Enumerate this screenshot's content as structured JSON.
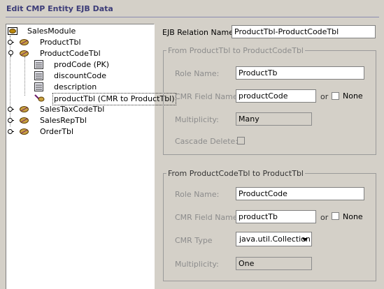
{
  "header": {
    "title": "Edit CMP Entity EJB Data"
  },
  "tree": {
    "root": "SalesModule",
    "items": [
      {
        "label": "ProductTbl"
      },
      {
        "label": "ProductCodeTbl"
      },
      {
        "label": "prodCode (PK)"
      },
      {
        "label": "discountCode"
      },
      {
        "label": "description"
      },
      {
        "label": "productTbl (CMR to ProductTbl)"
      },
      {
        "label": "SalesTaxCodeTbl"
      },
      {
        "label": "SalesRepTbl"
      },
      {
        "label": "OrderTbl"
      }
    ]
  },
  "relation": {
    "label": "EJB Relation Name",
    "value": "ProductTbl-ProductCodeTbl"
  },
  "group1": {
    "title": "From ProductTbl to ProductCodeTbl",
    "role_label": "Role Name:",
    "role_value": "ProductTb",
    "cmr_label": "CMR Field Name:",
    "cmr_value": "productCode",
    "or": "or",
    "none_label": "None",
    "mult_label": "Multiplicity:",
    "mult_value": "Many",
    "cascade_label": "Cascade Delete:"
  },
  "group2": {
    "title": "From ProductCodeTbl to ProductTbl",
    "role_label": "Role Name:",
    "role_value": "ProductCode",
    "cmr_label": "CMR Field Name:",
    "cmr_value": "productTb",
    "or": "or",
    "none_label": "None",
    "type_label": "CMR Type",
    "type_value": "java.util.Collection",
    "mult_label": "Multiplicity:",
    "mult_value": "One"
  }
}
